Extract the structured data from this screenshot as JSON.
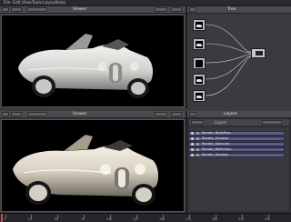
{
  "menubar": {
    "items": [
      "File",
      "Edit",
      "View",
      "Tools",
      "Layout",
      "Help"
    ]
  },
  "top_viewer": {
    "title": "Viewer",
    "tab_label": "Scene"
  },
  "bottom_viewer": {
    "title": "Viewer",
    "tab_label": "Final"
  },
  "node_editor": {
    "title": "Tree"
  },
  "layer_panel": {
    "title": "Layers",
    "tab_label": "Layers",
    "layers": [
      {
        "label": "Render_BodyPass"
      },
      {
        "label": "Render_Chrome"
      },
      {
        "label": "Render_Specular"
      },
      {
        "label": "Render_Reflection"
      },
      {
        "label": "Render_Shadow"
      }
    ]
  },
  "timeline": {
    "ticks": [
      "1",
      "25",
      "50",
      "75",
      "100",
      "125",
      "150",
      "175",
      "200",
      "225",
      "250"
    ]
  },
  "colors": {
    "ui_bg": "#3b3b40",
    "layer_row": "#5b5c8a",
    "playhead": "#dd4444"
  }
}
